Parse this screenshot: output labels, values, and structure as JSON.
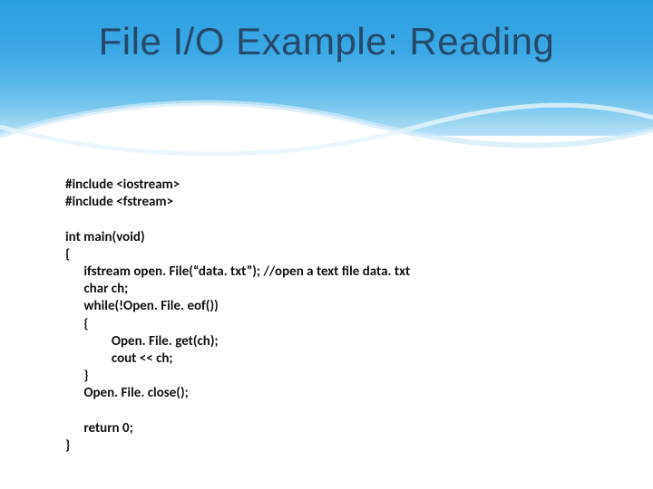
{
  "title": "File I/O Example: Reading",
  "code": {
    "l1": "#include <iostream>",
    "l2": "#include <fstream>",
    "l3": "",
    "l4": "int main(void)",
    "l5": "{",
    "l6": "      ifstream open. File(“data. txt”); //open a text file data. txt",
    "l7": "      char ch;",
    "l8": "      while(!Open. File. eof())",
    "l9": "      {",
    "l10": "               Open. File. get(ch);",
    "l11": "               cout << ch;",
    "l12": "      }",
    "l13": "      Open. File. close();",
    "l14": "",
    "l15": "      return 0;",
    "l16": "}"
  }
}
